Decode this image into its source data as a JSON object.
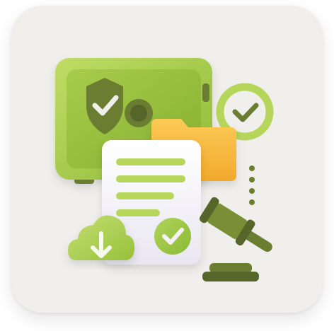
{
  "icon": {
    "name": "compliance-secure-documents-icon",
    "elements": [
      "safe-icon",
      "shield-check-icon",
      "folder-icon",
      "document-icon",
      "checkmark-badge-icon",
      "cloud-download-icon",
      "gavel-icon"
    ]
  },
  "colors": {
    "tile_background": "#f1efec",
    "lime_light": "#b6d65b",
    "lime": "#97c13a",
    "olive": "#6b7d30",
    "olive_dark": "#56662a",
    "folder": "#f6b93b",
    "paper": "#f4f1f8"
  }
}
